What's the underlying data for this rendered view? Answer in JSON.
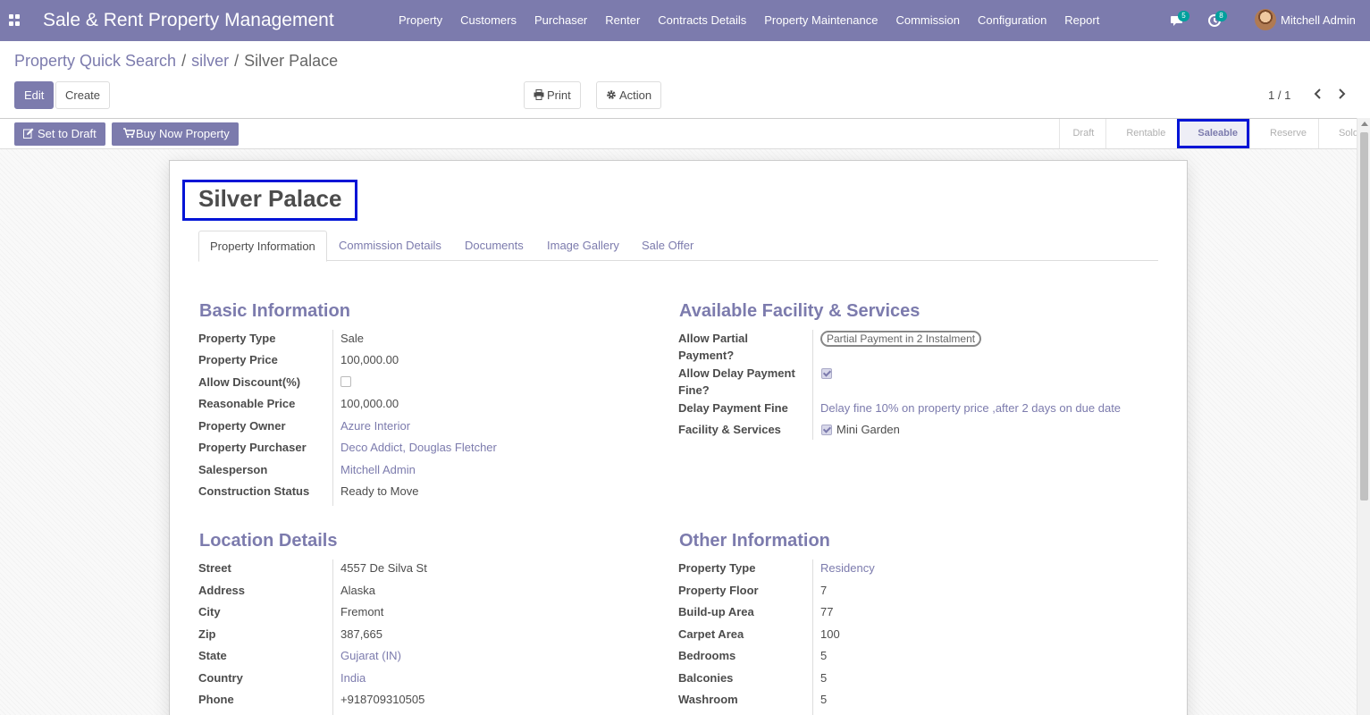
{
  "navbar": {
    "brand": "Sale & Rent Property Management",
    "menu": [
      "Property",
      "Customers",
      "Purchaser",
      "Renter",
      "Contracts Details",
      "Property Maintenance",
      "Commission",
      "Configuration",
      "Report"
    ],
    "messages_count": "5",
    "activities_count": "8",
    "user_name": "Mitchell Admin",
    "color": "#7c7bad"
  },
  "breadcrumb": {
    "items": [
      "Property Quick Search",
      "silver"
    ],
    "active": "Silver Palace",
    "separator": "/"
  },
  "toolbar": {
    "edit_label": "Edit",
    "create_label": "Create",
    "print_label": "Print",
    "action_label": "Action",
    "pager": "1 / 1"
  },
  "statusbar": {
    "set_to_draft_label": "Set to Draft",
    "buy_now_label": "Buy Now Property",
    "stages": [
      "Draft",
      "Rentable",
      "Saleable",
      "Reserve",
      "Sold"
    ],
    "current_stage": "Saleable"
  },
  "record": {
    "title": "Silver Palace",
    "tabs": [
      "Property Information",
      "Commission Details",
      "Documents",
      "Image Gallery",
      "Sale Offer"
    ],
    "active_tab": "Property Information"
  },
  "basic_information": {
    "title": "Basic Information",
    "fields": [
      {
        "label": "Property Type",
        "value": "Sale"
      },
      {
        "label": "Property Price",
        "value": "100,000.00"
      },
      {
        "label": "Allow Discount(%)",
        "value": ""
      },
      {
        "label": "Reasonable Price",
        "value": "100,000.00"
      },
      {
        "label": "Property Owner",
        "value": "Azure Interior"
      },
      {
        "label": "Property Purchaser",
        "value": "Deco Addict, Douglas Fletcher"
      },
      {
        "label": "Salesperson",
        "value": "Mitchell Admin"
      },
      {
        "label": "Construction Status",
        "value": "Ready to Move"
      }
    ]
  },
  "facility_services": {
    "title": "Available Facility & Services",
    "allow_partial_label_1": "Allow Partial",
    "allow_partial_label_2": "Payment?",
    "partial_tag": "Partial Payment in 2 Instalment",
    "allow_delay_label_1": "Allow Delay Payment",
    "allow_delay_label_2": "Fine?",
    "delay_fine_label": "Delay Payment Fine",
    "delay_fine_value": "Delay fine 10% on property price ,after 2 days on due date",
    "facility_label": "Facility & Services",
    "facility_value": "Mini Garden"
  },
  "location_details": {
    "title": "Location Details",
    "fields": [
      {
        "label": "Street",
        "value": "4557 De Silva St"
      },
      {
        "label": "Address",
        "value": "Alaska"
      },
      {
        "label": "City",
        "value": "Fremont"
      },
      {
        "label": "Zip",
        "value": "387,665"
      },
      {
        "label": "State",
        "value": "Gujarat (IN)"
      },
      {
        "label": "Country",
        "value": "India"
      },
      {
        "label": "Phone",
        "value": "+918709310505"
      }
    ]
  },
  "other_information": {
    "title": "Other Information",
    "fields": [
      {
        "label": "Property Type",
        "value": "Residency"
      },
      {
        "label": "Property Floor",
        "value": "7"
      },
      {
        "label": "Build-up Area",
        "value": "77"
      },
      {
        "label": "Carpet Area",
        "value": "100"
      },
      {
        "label": "Bedrooms",
        "value": "5"
      },
      {
        "label": "Balconies",
        "value": "5"
      },
      {
        "label": "Washroom",
        "value": "5"
      }
    ]
  }
}
